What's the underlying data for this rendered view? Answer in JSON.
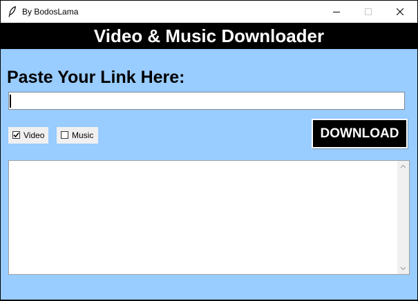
{
  "window": {
    "title": "By BodosLama",
    "app_icon": "feather-icon",
    "controls": [
      "minimize-icon",
      "maximize-icon",
      "close-icon"
    ]
  },
  "header": {
    "title": "Video & Music Downloader"
  },
  "main": {
    "prompt_label": "Paste Your Link Here:",
    "url_input": {
      "value": "",
      "placeholder": ""
    },
    "options": [
      {
        "label": "Video",
        "checked": true
      },
      {
        "label": "Music",
        "checked": false
      }
    ],
    "download_label": "DOWNLOAD",
    "output_text": ""
  },
  "colors": {
    "background": "#99ccff",
    "header_bg": "#000000",
    "header_text": "#ffffff",
    "button_bg": "#000000",
    "button_text": "#ffffff"
  }
}
